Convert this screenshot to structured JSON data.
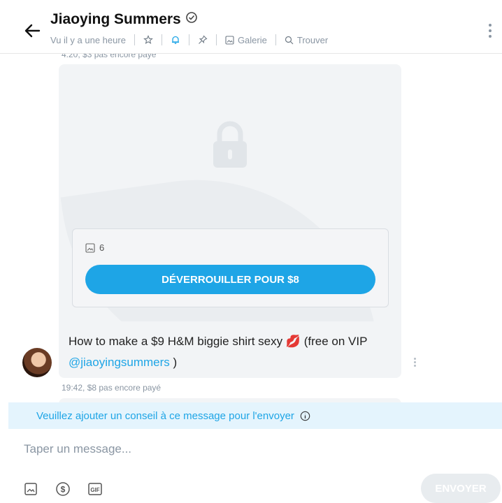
{
  "header": {
    "name": "Jiaoying Summers",
    "last_seen": "Vu il y a une heure",
    "gallery_label": "Galerie",
    "search_label": "Trouver"
  },
  "messages": [
    {
      "meta": "4:20, $3 pas encore payé"
    },
    {
      "media_count": "6",
      "unlock_label": "DÉVERROUILLER POUR $8",
      "text_before": "How to make a $9 H&M biggie shirt sexy 💋 (free on VIP ",
      "mention": "@jiaoyingsummers",
      "text_after": " )",
      "meta": "19:42, $8 pas encore payé"
    }
  ],
  "banner": {
    "text": "Veuillez ajouter un conseil à ce message pour l'envoyer"
  },
  "composer": {
    "placeholder": "Taper un message...",
    "send_label": "ENVOYER"
  },
  "colors": {
    "accent": "#1ea5e6",
    "bubble": "#f2f4f6",
    "banner_bg": "#e4f4fd"
  }
}
